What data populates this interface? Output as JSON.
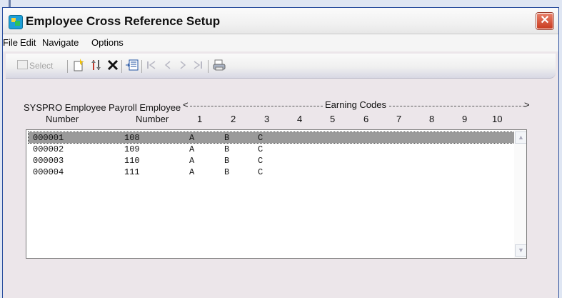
{
  "window": {
    "title": "Employee Cross Reference Setup",
    "close_label": "✕"
  },
  "menu": {
    "file": "File",
    "edit": "Edit",
    "navigate": "Navigate",
    "options": "Options"
  },
  "toolbar": {
    "select_label": "Select"
  },
  "headers": {
    "syspro_line1": "SYSPRO Employee",
    "payroll_line1": "Payroll Employee",
    "syspro_line2": "Number",
    "payroll_line2": "Number",
    "earning_codes": "Earning Codes",
    "arrow_left": "<",
    "arrow_right": ">",
    "columns": [
      "1",
      "2",
      "3",
      "4",
      "5",
      "6",
      "7",
      "8",
      "9",
      "10"
    ]
  },
  "rows": [
    {
      "syspro": "000001",
      "payroll": "108",
      "c1": "A",
      "c2": "B",
      "c3": "C"
    },
    {
      "syspro": "000002",
      "payroll": "109",
      "c1": "A",
      "c2": "B",
      "c3": "C"
    },
    {
      "syspro": "000003",
      "payroll": "110",
      "c1": "A",
      "c2": "B",
      "c3": "C"
    },
    {
      "syspro": "000004",
      "payroll": "111",
      "c1": "A",
      "c2": "B",
      "c3": "C"
    }
  ],
  "scrollbar": {
    "up": "▲",
    "down": "▼"
  }
}
